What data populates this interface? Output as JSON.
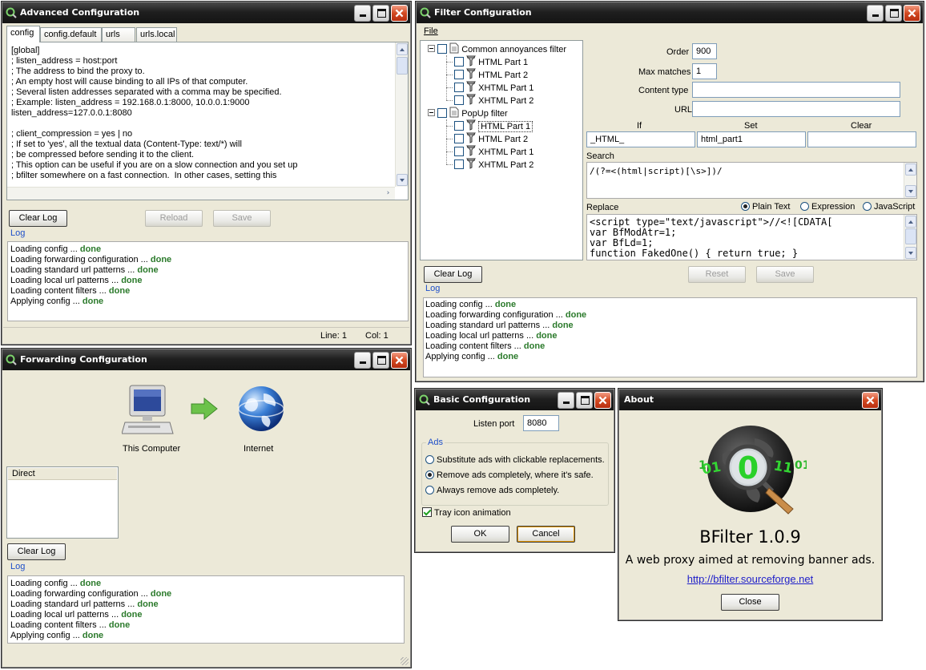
{
  "advanced": {
    "title": "Advanced Configuration",
    "tabs": [
      "config",
      "config.default",
      "urls",
      "urls.local"
    ],
    "config_lines": [
      "[global]",
      "; listen_address = host:port",
      "; The address to bind the proxy to.",
      "; An empty host will cause binding to all IPs of that computer.",
      "; Several listen addresses separated with a comma may be specified.",
      "; Example: listen_address = 192.168.0.1:8000, 10.0.0.1:9000",
      "listen_address=127.0.0.1:8080",
      "",
      "; client_compression = yes | no",
      "; If set to 'yes', all the textual data (Content-Type: text/*) will",
      "; be compressed before sending it to the client.",
      "; This option can be useful if you are on a slow connection and you set up",
      "; bfilter somewhere on a fast connection.  In other cases, setting this"
    ],
    "clear_log": "Clear Log",
    "reload": "Reload",
    "save": "Save",
    "log_label": "Log",
    "line_status": "Line: 1",
    "col_status": "Col: 1"
  },
  "log_entries": [
    {
      "text": "Loading config ... ",
      "status": "done"
    },
    {
      "text": "Loading forwarding configuration ... ",
      "status": "done"
    },
    {
      "text": "Loading standard url patterns ... ",
      "status": "done"
    },
    {
      "text": "Loading local url patterns ... ",
      "status": "done"
    },
    {
      "text": "Loading content filters ... ",
      "status": "done"
    },
    {
      "text": "Applying config ... ",
      "status": "done"
    }
  ],
  "filter": {
    "title": "Filter Configuration",
    "menu_file": "File",
    "tree": [
      {
        "label": "Common annoyances filter",
        "children": [
          "HTML Part 1",
          "HTML Part 2",
          "XHTML Part 1",
          "XHTML Part 2"
        ]
      },
      {
        "label": "PopUp filter",
        "children": [
          "HTML Part 1",
          "HTML Part 2",
          "XHTML Part 1",
          "XHTML Part 2"
        ]
      }
    ],
    "order_label": "Order",
    "order_value": "900",
    "max_matches_label": "Max matches",
    "max_matches_value": "1",
    "content_type_label": "Content type",
    "content_type_value": "",
    "url_label": "URL",
    "url_value": "",
    "if_label": "If",
    "set_label": "Set",
    "clear_label": "Clear",
    "if_value": "_HTML_",
    "set_value": "html_part1",
    "clear_value": "",
    "search_label": "Search",
    "search_value": "/(?=<(html|script)[\\s>])/",
    "replace_label": "Replace",
    "replace_modes": [
      "Plain Text",
      "Expression",
      "JavaScript"
    ],
    "replace_lines": [
      "<script type=\"text/javascript\">//<![CDATA[",
      "var BfModAtr=1;",
      "var BfLd=1;",
      "function FakedOne() { return true; }"
    ],
    "clear_log": "Clear Log",
    "reset": "Reset",
    "save": "Save",
    "log_label": "Log"
  },
  "forwarding": {
    "title": "Forwarding Configuration",
    "computer_label": "This Computer",
    "internet_label": "Internet",
    "list_items": [
      "Direct"
    ],
    "clear_log": "Clear Log",
    "log_label": "Log"
  },
  "basic": {
    "title": "Basic Configuration",
    "listen_port_label": "Listen port",
    "listen_port_value": "8080",
    "ads_group": "Ads",
    "ad_options": [
      "Substitute ads with clickable replacements.",
      "Remove ads completely, where it's safe.",
      "Always remove ads completely."
    ],
    "tray_label": "Tray icon animation",
    "ok": "OK",
    "cancel": "Cancel"
  },
  "about": {
    "title": "About",
    "app_name": "BFilter 1.0.9",
    "tagline": "A web proxy aimed at removing banner ads.",
    "link": "http://bfilter.sourceforge.net",
    "close": "Close",
    "logo_digits": "01 0 11"
  },
  "colors": {
    "done": "#2b7a2b",
    "link": "#1e4fc9",
    "titlebar": "#1f1f1f",
    "close_button": "#d24a22"
  }
}
